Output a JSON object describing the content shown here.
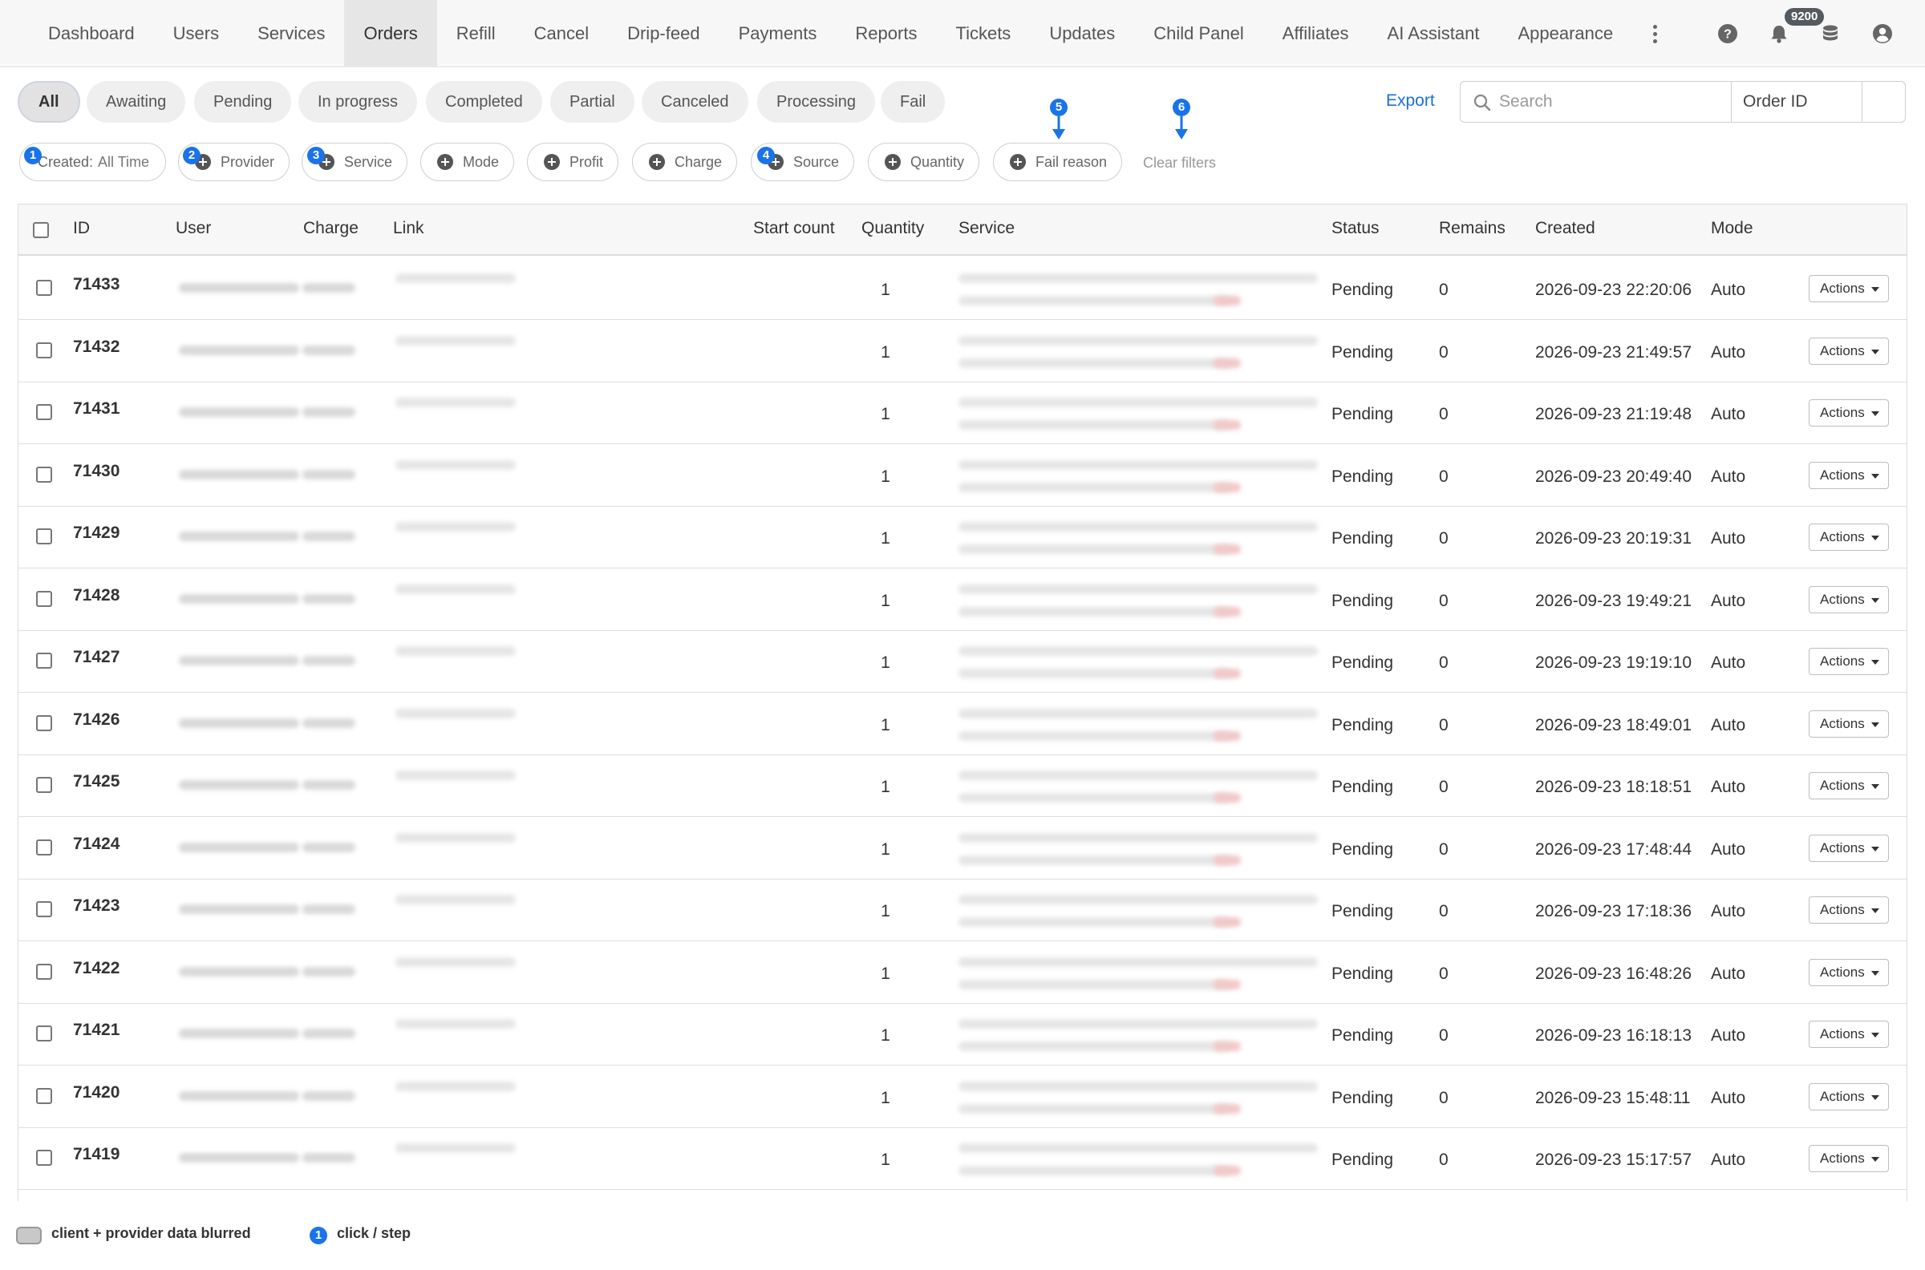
{
  "nav": {
    "items": [
      "Dashboard",
      "Users",
      "Services",
      "Orders",
      "Refill",
      "Cancel",
      "Drip-feed",
      "Payments",
      "Reports",
      "Tickets",
      "Updates",
      "Child Panel",
      "Affiliates",
      "AI Assistant",
      "Appearance"
    ],
    "active": "Orders",
    "balance_badge": "9200",
    "icons": [
      "help-icon",
      "bell-icon",
      "coins-icon",
      "account-icon"
    ]
  },
  "tabs": [
    "All",
    "Awaiting",
    "Pending",
    "In progress",
    "Completed",
    "Partial",
    "Canceled",
    "Processing",
    "Fail"
  ],
  "active_tab": "All",
  "toolbar": {
    "export_label": "Export",
    "search_placeholder": "Search",
    "search_by": "Order ID"
  },
  "filters": {
    "created_label": "Created:",
    "created_value": "All Time",
    "chips": [
      "Provider",
      "Service",
      "Mode",
      "Profit",
      "Charge",
      "Source",
      "Quantity",
      "Fail reason"
    ],
    "clear_label": "Clear filters"
  },
  "steps": [
    "1",
    "2",
    "3",
    "4",
    "5",
    "6"
  ],
  "table": {
    "columns": [
      "ID",
      "User",
      "Charge",
      "Link",
      "Start count",
      "Quantity",
      "Service",
      "Status",
      "Remains",
      "Created",
      "Mode"
    ],
    "action_label": "Actions",
    "rows": [
      {
        "id": "71433",
        "quantity": "1",
        "status": "Pending",
        "remains": "0",
        "created": "2026-09-23 22:20:06",
        "mode": "Auto"
      },
      {
        "id": "71432",
        "quantity": "1",
        "status": "Pending",
        "remains": "0",
        "created": "2026-09-23 21:49:57",
        "mode": "Auto"
      },
      {
        "id": "71431",
        "quantity": "1",
        "status": "Pending",
        "remains": "0",
        "created": "2026-09-23 21:19:48",
        "mode": "Auto"
      },
      {
        "id": "71430",
        "quantity": "1",
        "status": "Pending",
        "remains": "0",
        "created": "2026-09-23 20:49:40",
        "mode": "Auto"
      },
      {
        "id": "71429",
        "quantity": "1",
        "status": "Pending",
        "remains": "0",
        "created": "2026-09-23 20:19:31",
        "mode": "Auto"
      },
      {
        "id": "71428",
        "quantity": "1",
        "status": "Pending",
        "remains": "0",
        "created": "2026-09-23 19:49:21",
        "mode": "Auto"
      },
      {
        "id": "71427",
        "quantity": "1",
        "status": "Pending",
        "remains": "0",
        "created": "2026-09-23 19:19:10",
        "mode": "Auto"
      },
      {
        "id": "71426",
        "quantity": "1",
        "status": "Pending",
        "remains": "0",
        "created": "2026-09-23 18:49:01",
        "mode": "Auto"
      },
      {
        "id": "71425",
        "quantity": "1",
        "status": "Pending",
        "remains": "0",
        "created": "2026-09-23 18:18:51",
        "mode": "Auto"
      },
      {
        "id": "71424",
        "quantity": "1",
        "status": "Pending",
        "remains": "0",
        "created": "2026-09-23 17:48:44",
        "mode": "Auto"
      },
      {
        "id": "71423",
        "quantity": "1",
        "status": "Pending",
        "remains": "0",
        "created": "2026-09-23 17:18:36",
        "mode": "Auto"
      },
      {
        "id": "71422",
        "quantity": "1",
        "status": "Pending",
        "remains": "0",
        "created": "2026-09-23 16:48:26",
        "mode": "Auto"
      },
      {
        "id": "71421",
        "quantity": "1",
        "status": "Pending",
        "remains": "0",
        "created": "2026-09-23 16:18:13",
        "mode": "Auto"
      },
      {
        "id": "71420",
        "quantity": "1",
        "status": "Pending",
        "remains": "0",
        "created": "2026-09-23 15:48:11",
        "mode": "Auto"
      },
      {
        "id": "71419",
        "quantity": "1",
        "status": "Pending",
        "remains": "0",
        "created": "2026-09-23 15:17:57",
        "mode": "Auto"
      }
    ]
  },
  "legend": {
    "blurred_label": "client + provider data blurred",
    "step_label": "click / step",
    "step_number": "1"
  },
  "colors": {
    "accent": "#1a73e8",
    "link": "#1a6fd6"
  }
}
